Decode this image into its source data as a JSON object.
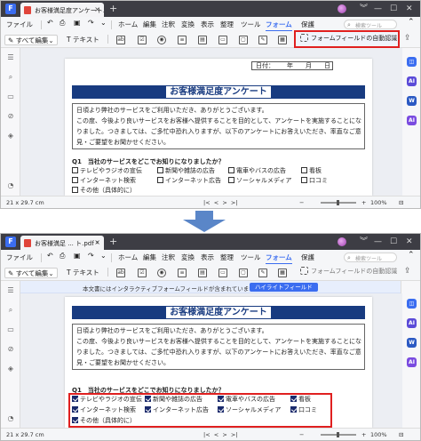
{
  "top": {
    "tab_title": "お客様満足度アンケート.pdf",
    "close_glyph": "×",
    "add_tab_glyph": "+",
    "app_logo": "F",
    "window_controls": [
      "︾",
      "—",
      "☐",
      "✕"
    ]
  },
  "bottom": {
    "tab_title": "お客様満足 ... ト.pdf *",
    "close_glyph": "×",
    "add_tab_glyph": "+",
    "app_logo": "F",
    "window_controls": [
      "︾",
      "—",
      "☐",
      "✕"
    ]
  },
  "menu": {
    "file": "ファイル",
    "items": [
      "ホーム",
      "編集",
      "注釈",
      "変換",
      "表示",
      "整理",
      "ツール",
      "フォーム",
      "保護"
    ],
    "active": "フォーム",
    "search_placeholder": "検索ツール"
  },
  "toolbar": {
    "edit_all": "すべて編集",
    "text": "テキスト",
    "field_icons": [
      "ab",
      "☑",
      "◉",
      "≡",
      "▤",
      "▭",
      "▢",
      "✎",
      "▦",
      "⊞"
    ],
    "auto_recognize": "フォームフィールドの自動認識"
  },
  "info_bar": {
    "message": "本文書にはインタラクティブフォームフィールドが含まれています。",
    "highlight_button": "ハイライトフィールド"
  },
  "document": {
    "date_label": "日付：",
    "date_sep1": "年",
    "date_sep2": "月",
    "date_sep3": "日",
    "title": "お客様満足度アンケート",
    "intro_lines": [
      "日頃より弊社のサービスをご利用いただき、ありがとうございます。",
      "この度、今後より良いサービスをお客様へ提供することを目的として、アンケートを実施することにな",
      "りました。つきましては、ご多忙中恐れ入りますが、以下のアンケートにお答えいただき、率直なご意",
      "見・ご要望をお聞かせください。"
    ],
    "question1": "Q1　当社のサービスをどこでお知りになりましたか？",
    "options_row1": [
      "テレビやラジオの宣伝",
      "新聞や雑誌の広告",
      "電車やバスの広告",
      "看板"
    ],
    "options_row2": [
      "インターネット検索",
      "インターネット広告",
      "ソーシャルメディア",
      "口コミ"
    ],
    "options_row3": [
      "その他（具体的に）"
    ]
  },
  "status": {
    "page_size": "21 x 29.7 cm",
    "zoom": "100%"
  },
  "sidebar": {
    "left_icons": [
      "☰",
      "⌕",
      "▭",
      "⊘",
      "◈",
      "◔"
    ],
    "right_badges": [
      "◫",
      "AI",
      "W",
      "AI"
    ]
  }
}
